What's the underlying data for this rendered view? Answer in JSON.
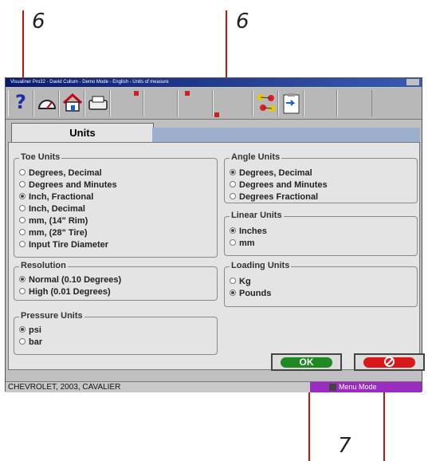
{
  "callouts": {
    "left_top": "6",
    "right_top": "6",
    "bottom": "7"
  },
  "window": {
    "title": "Visualiner Pro32 - David Cullum - Demo Mode - English - Units of measure"
  },
  "toolbar": {
    "help_icon": "?"
  },
  "tab": {
    "label": "Units"
  },
  "toe_units": {
    "legend": "Toe Units",
    "options": [
      "Degrees, Decimal",
      "Degrees and Minutes",
      "Inch, Fractional",
      "Inch, Decimal",
      "mm, (14\" Rim)",
      "mm, (28\" Tire)",
      "Input Tire Diameter"
    ]
  },
  "resolution": {
    "legend": "Resolution",
    "options": [
      "Normal (0.10 Degrees)",
      "High (0.01 Degrees)"
    ]
  },
  "pressure_units": {
    "legend": "Pressure Units",
    "options": [
      "psi",
      "bar"
    ]
  },
  "angle_units": {
    "legend": "Angle Units",
    "options": [
      "Degrees, Decimal",
      "Degrees and Minutes",
      "Degrees Fractional"
    ]
  },
  "linear_units": {
    "legend": "Linear Units",
    "options": [
      "Inches",
      "mm"
    ]
  },
  "loading_units": {
    "legend": "Loading Units",
    "options": [
      "Kg",
      "Pounds"
    ]
  },
  "buttons": {
    "ok_label": "OK"
  },
  "status": {
    "vehicle": "CHEVROLET, 2003, CAVALIER",
    "mode": "Menu Mode"
  },
  "colors": {
    "ok_green": "#1f8a22",
    "cancel_red": "#d61a1a",
    "mode_purple": "#9b2cc0",
    "callout_line": "#cc1111"
  },
  "icons": [
    "help-icon",
    "gauge-icon",
    "home-icon",
    "printer-icon",
    "molecule-icon",
    "clipboard-icon",
    "no-entry-icon"
  ]
}
